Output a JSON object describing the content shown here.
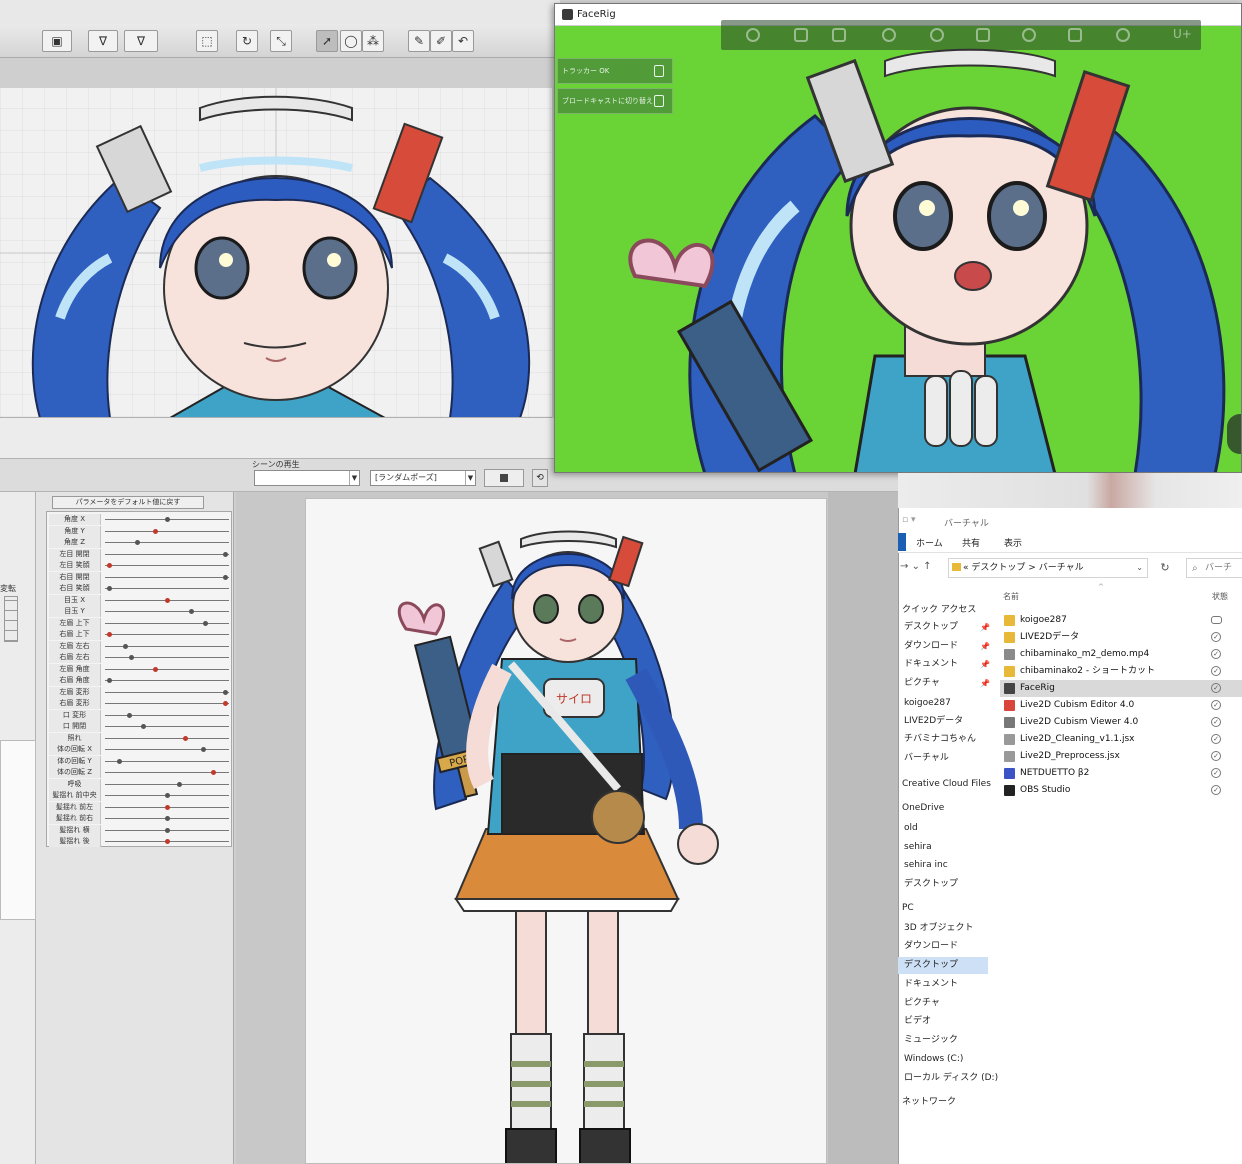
{
  "editor": {
    "toolbar": {
      "buttons": [
        {
          "icon": "deformer-icon"
        },
        {
          "icon": "mesh-icon"
        },
        {
          "icon": "auto-mesh-icon"
        },
        {
          "icon": "lasso-select-icon"
        },
        {
          "icon": "rotate-icon"
        },
        {
          "icon": "transform-icon"
        },
        {
          "icon": "arrow-select-icon"
        },
        {
          "icon": "lasso-icon"
        },
        {
          "icon": "brush-select-icon"
        },
        {
          "icon": "pen-icon"
        },
        {
          "icon": "pin-icon"
        },
        {
          "icon": "undo-stroke-icon"
        }
      ]
    },
    "scene_playback": {
      "label": "シーンの再生",
      "scene_select_value": "",
      "pose_select_value": "[ランダムポーズ]"
    },
    "left_mini_label": "変転",
    "parameters": {
      "reset_label": "パラメータをデフォルト値に戻す",
      "items": [
        {
          "name": "角度 X",
          "knob": 0.5
        },
        {
          "name": "角度 Y",
          "knob": 0.4
        },
        {
          "name": "角度 Z",
          "knob": 0.25
        },
        {
          "name": "左目 開閉",
          "knob": 0.98
        },
        {
          "name": "左目 笑顔",
          "knob": 0.02
        },
        {
          "name": "右目 開閉",
          "knob": 0.98
        },
        {
          "name": "右目 笑顔",
          "knob": 0.02
        },
        {
          "name": "目玉 X",
          "knob": 0.5
        },
        {
          "name": "目玉 Y",
          "knob": 0.7
        },
        {
          "name": "左眉 上下",
          "knob": 0.82
        },
        {
          "name": "右眉 上下",
          "knob": 0.02
        },
        {
          "name": "左眉 左右",
          "knob": 0.15
        },
        {
          "name": "右眉 左右",
          "knob": 0.2
        },
        {
          "name": "左眉 角度",
          "knob": 0.4
        },
        {
          "name": "右眉 角度",
          "knob": 0.02
        },
        {
          "name": "左眉 変形",
          "knob": 0.98
        },
        {
          "name": "右眉 変形",
          "knob": 0.98
        },
        {
          "name": "口 変形",
          "knob": 0.18
        },
        {
          "name": "口 開閉",
          "knob": 0.3
        },
        {
          "name": "照れ",
          "knob": 0.65
        },
        {
          "name": "体の回転 X",
          "knob": 0.8
        },
        {
          "name": "体の回転 Y",
          "knob": 0.1
        },
        {
          "name": "体の回転 Z",
          "knob": 0.88
        },
        {
          "name": "呼吸",
          "knob": 0.6
        },
        {
          "name": "髪揺れ 前中央",
          "knob": 0.5
        },
        {
          "name": "髪揺れ 前左",
          "knob": 0.5
        },
        {
          "name": "髪揺れ 前右",
          "knob": 0.5
        },
        {
          "name": "髪揺れ 横",
          "knob": 0.5
        },
        {
          "name": "髪揺れ 後",
          "knob": 0.5
        }
      ]
    }
  },
  "facerig": {
    "title": "FaceRig",
    "toolbar_icons": [
      "avatar-icon",
      "environment-icon",
      "profile-icon",
      "person-icon",
      "mouth-icon",
      "camera-icon",
      "cloud-icon",
      "window-icon",
      "refresh-icon"
    ],
    "toolbar_extra": "U+",
    "chips": [
      {
        "label": "トラッカー OK",
        "icon": "shield-icon"
      },
      {
        "label": "ブロードキャストに切り替え",
        "icon": "broadcast-icon"
      }
    ],
    "background_color": "#6ad336"
  },
  "explorer": {
    "title": "バーチャル",
    "ribbon_tabs": [
      "ホーム",
      "共有",
      "表示"
    ],
    "address": {
      "root": "«",
      "path": [
        "デスクトップ",
        "バーチャル"
      ],
      "separator": ">"
    },
    "search_placeholder": "バーチ",
    "columns": {
      "name": "名前",
      "status": "状態"
    },
    "nav": [
      {
        "label": "クイック アクセス",
        "type": "header"
      },
      {
        "label": "デスクトップ",
        "pinned": true
      },
      {
        "label": "ダウンロード",
        "pinned": true
      },
      {
        "label": "ドキュメント",
        "pinned": true
      },
      {
        "label": "ピクチャ",
        "pinned": true
      },
      {
        "label": "koigoe287"
      },
      {
        "label": "LIVE2Dデータ"
      },
      {
        "label": "チバミナコちゃん"
      },
      {
        "label": "バーチャル"
      },
      {
        "label": "Creative Cloud Files",
        "type": "header"
      },
      {
        "label": "OneDrive",
        "type": "header"
      },
      {
        "label": "old"
      },
      {
        "label": "sehira"
      },
      {
        "label": "sehira inc"
      },
      {
        "label": "デスクトップ"
      },
      {
        "label": "PC",
        "type": "header"
      },
      {
        "label": "3D オブジェクト"
      },
      {
        "label": "ダウンロード"
      },
      {
        "label": "デスクトップ",
        "selected": true
      },
      {
        "label": "ドキュメント"
      },
      {
        "label": "ピクチャ"
      },
      {
        "label": "ビデオ"
      },
      {
        "label": "ミュージック"
      },
      {
        "label": "Windows (C:)"
      },
      {
        "label": "ローカル ディスク (D:)"
      },
      {
        "label": "ネットワーク",
        "type": "header"
      }
    ],
    "files": [
      {
        "name": "koigoe287",
        "icon": "folder-icon",
        "color": "#e8b838",
        "status": "cloud"
      },
      {
        "name": "LIVE2Dデータ",
        "icon": "folder-icon",
        "color": "#e8b838",
        "status": "check"
      },
      {
        "name": "chibaminako_m2_demo.mp4",
        "icon": "video-file-icon",
        "color": "#8a8a8a",
        "status": "check"
      },
      {
        "name": "chibaminako2 - ショートカット",
        "icon": "shortcut-icon",
        "color": "#e8b838",
        "status": "check"
      },
      {
        "name": "FaceRig",
        "icon": "facerig-app-icon",
        "color": "#444444",
        "status": "check",
        "selected": true
      },
      {
        "name": "Live2D Cubism Editor 4.0",
        "icon": "cubism-editor-icon",
        "color": "#d9453b",
        "status": "check"
      },
      {
        "name": "Live2D Cubism Viewer 4.0",
        "icon": "cubism-viewer-icon",
        "color": "#777777",
        "status": "check"
      },
      {
        "name": "Live2D_Cleaning_v1.1.jsx",
        "icon": "script-file-icon",
        "color": "#999999",
        "status": "check"
      },
      {
        "name": "Live2D_Preprocess.jsx",
        "icon": "script-file-icon",
        "color": "#999999",
        "status": "check"
      },
      {
        "name": "NETDUETTO β2",
        "icon": "netduetto-icon",
        "color": "#3b53c4",
        "status": "check"
      },
      {
        "name": "OBS Studio",
        "icon": "obs-icon",
        "color": "#222222",
        "status": "check"
      }
    ]
  },
  "character": {
    "emblem_text": "サイロ",
    "sword_text": "PORT"
  }
}
